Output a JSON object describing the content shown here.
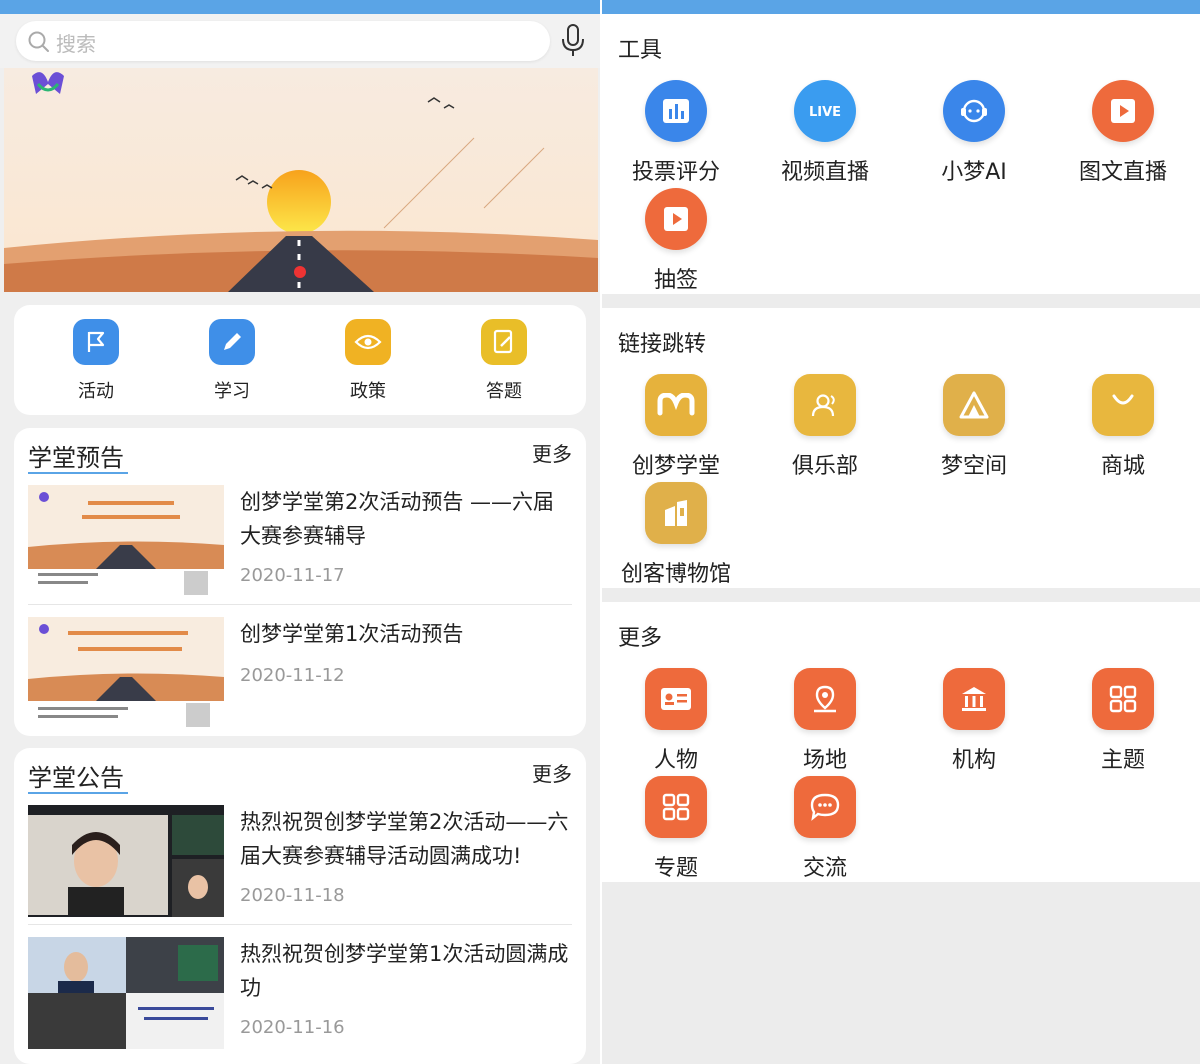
{
  "search": {
    "placeholder": "搜索"
  },
  "categories": [
    {
      "label": "活动",
      "icon": "flag-icon",
      "color": "#3f8fe8"
    },
    {
      "label": "学习",
      "icon": "pencil-icon",
      "color": "#3f8fe8"
    },
    {
      "label": "政策",
      "icon": "eye-icon",
      "color": "#f0b223"
    },
    {
      "label": "答题",
      "icon": "edit-doc-icon",
      "color": "#e9be28"
    }
  ],
  "preview": {
    "title": "学堂预告",
    "more": "更多",
    "items": [
      {
        "title": "创梦学堂第2次活动预告 ——六届大赛参赛辅导",
        "date": "2020-11-17"
      },
      {
        "title": "创梦学堂第1次活动预告",
        "date": "2020-11-12"
      }
    ]
  },
  "notice": {
    "title": "学堂公告",
    "more": "更多",
    "items": [
      {
        "title": "热烈祝贺创梦学堂第2次活动——六届大赛参赛辅导活动圆满成功!",
        "date": "2020-11-18"
      },
      {
        "title": "热烈祝贺创梦学堂第1次活动圆满成功",
        "date": "2020-11-16"
      }
    ]
  },
  "tools": {
    "heading": "工具",
    "items": [
      {
        "label": "投票评分",
        "icon": "bar-chart-icon"
      },
      {
        "label": "视频直播",
        "icon": "live-icon"
      },
      {
        "label": "小梦AI",
        "icon": "headset-icon"
      },
      {
        "label": "图文直播",
        "icon": "play-icon"
      },
      {
        "label": "抽签",
        "icon": "play-icon"
      }
    ]
  },
  "links": {
    "heading": "链接跳转",
    "items": [
      {
        "label": "创梦学堂",
        "icon": "m-logo-icon"
      },
      {
        "label": "俱乐部",
        "icon": "users-icon"
      },
      {
        "label": "梦空间",
        "icon": "shape-icon"
      },
      {
        "label": "商城",
        "icon": "bag-icon"
      },
      {
        "label": "创客博物馆",
        "icon": "building-icon"
      }
    ]
  },
  "more_sec": {
    "heading": "更多",
    "items": [
      {
        "label": "人物",
        "icon": "id-card-icon"
      },
      {
        "label": "场地",
        "icon": "map-pin-icon"
      },
      {
        "label": "机构",
        "icon": "bank-icon"
      },
      {
        "label": "主题",
        "icon": "grid-icon"
      },
      {
        "label": "专题",
        "icon": "grid-icon"
      },
      {
        "label": "交流",
        "icon": "chat-icon"
      }
    ]
  },
  "colors": {
    "accent_blue": "#5aa4e6",
    "tools_blue": "#3a86ea",
    "links_gold": "#e6b23c",
    "more_orange": "#ee6a3c"
  }
}
